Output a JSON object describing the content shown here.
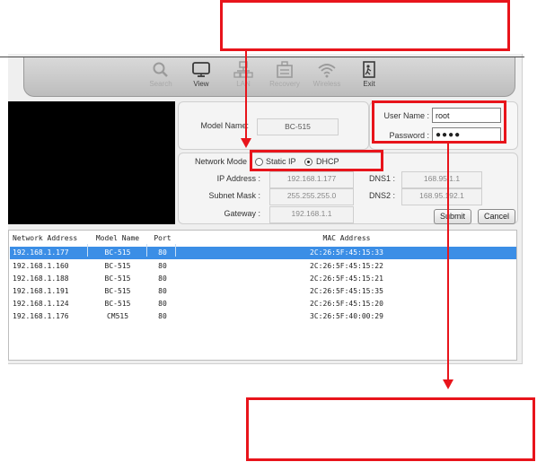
{
  "toolbar": {
    "items": [
      {
        "label": "Search",
        "icon": "magnifier-icon",
        "enabled": false
      },
      {
        "label": "View",
        "icon": "monitor-icon",
        "enabled": true
      },
      {
        "label": "LAN",
        "icon": "lan-icon",
        "enabled": false
      },
      {
        "label": "Recovery",
        "icon": "recovery-icon",
        "enabled": false
      },
      {
        "label": "Wireless",
        "icon": "wifi-icon",
        "enabled": false
      },
      {
        "label": "Exit",
        "icon": "exit-icon",
        "enabled": true
      }
    ]
  },
  "device": {
    "model_name_label": "Model Name:",
    "model_name_value": "BC-515"
  },
  "login": {
    "username_label": "User Name :",
    "username_value": "root",
    "password_label": "Password :",
    "password_value": "●●●●"
  },
  "network": {
    "mode_label": "Network Mode :",
    "static_label": "Static IP",
    "dhcp_label": "DHCP",
    "selected_mode": "DHCP",
    "ip_label": "IP Address :",
    "ip_value": "192.168.1.177",
    "subnet_label": "Subnet Mask :",
    "subnet_value": "255.255.255.0",
    "gateway_label": "Gateway :",
    "gateway_value": "192.168.1.1",
    "dns1_label": "DNS1 :",
    "dns1_value": "168.95.1.1",
    "dns2_label": "DNS2 :",
    "dns2_value": "168.95.192.1",
    "submit_label": "Submit",
    "cancel_label": "Cancel"
  },
  "table": {
    "headers": {
      "address": "Network Address",
      "model": "Model Name",
      "port": "Port",
      "mac": "MAC Address"
    },
    "rows": [
      {
        "address": "192.168.1.177",
        "model": "BC-515",
        "port": "80",
        "mac": "2C:26:5F:45:15:33",
        "selected": true
      },
      {
        "address": "192.168.1.160",
        "model": "BC-515",
        "port": "80",
        "mac": "2C:26:5F:45:15:22",
        "selected": false
      },
      {
        "address": "192.168.1.188",
        "model": "BC-515",
        "port": "80",
        "mac": "2C:26:5F:45:15:21",
        "selected": false
      },
      {
        "address": "192.168.1.191",
        "model": "BC-515",
        "port": "80",
        "mac": "2C:26:5F:45:15:35",
        "selected": false
      },
      {
        "address": "192.168.1.124",
        "model": "BC-515",
        "port": "80",
        "mac": "2C:26:5F:45:15:20",
        "selected": false
      },
      {
        "address": "192.168.1.176",
        "model": "CM515",
        "port": "80",
        "mac": "3C:26:5F:40:00:29",
        "selected": false
      }
    ]
  },
  "colors": {
    "annotation": "#e8141b",
    "selection": "#3b8ee6"
  }
}
